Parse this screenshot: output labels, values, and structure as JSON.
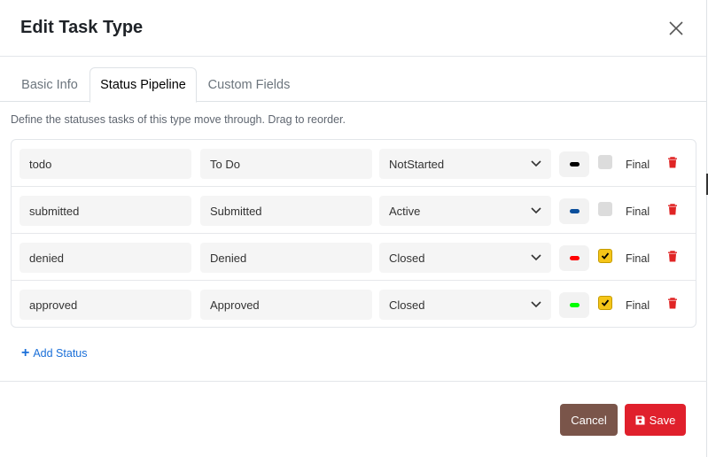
{
  "modal": {
    "title": "Edit Task Type"
  },
  "tabs": [
    {
      "label": "Basic Info",
      "active": false
    },
    {
      "label": "Status Pipeline",
      "active": true
    },
    {
      "label": "Custom Fields",
      "active": false
    }
  ],
  "description": "Define the statuses tasks of this type move through. Drag to reorder.",
  "statuses": [
    {
      "key": "todo",
      "label": "To Do",
      "category": "NotStarted",
      "color": "#000000",
      "final": false,
      "final_label": "Final"
    },
    {
      "key": "submitted",
      "label": "Submitted",
      "category": "Active",
      "color": "#0b4f9c",
      "final": false,
      "final_label": "Final"
    },
    {
      "key": "denied",
      "label": "Denied",
      "category": "Closed",
      "color": "#ff0000",
      "final": true,
      "final_label": "Final"
    },
    {
      "key": "approved",
      "label": "Approved",
      "category": "Closed",
      "color": "#00ff00",
      "final": true,
      "final_label": "Final"
    }
  ],
  "add_status_label": "Add Status",
  "footer": {
    "cancel_label": "Cancel",
    "save_label": "Save"
  },
  "colors": {
    "cancel": "#7a554a",
    "save": "#e0202c",
    "check_on": "#f5c518",
    "trash": "#e02424",
    "link": "#1a6fd8"
  }
}
